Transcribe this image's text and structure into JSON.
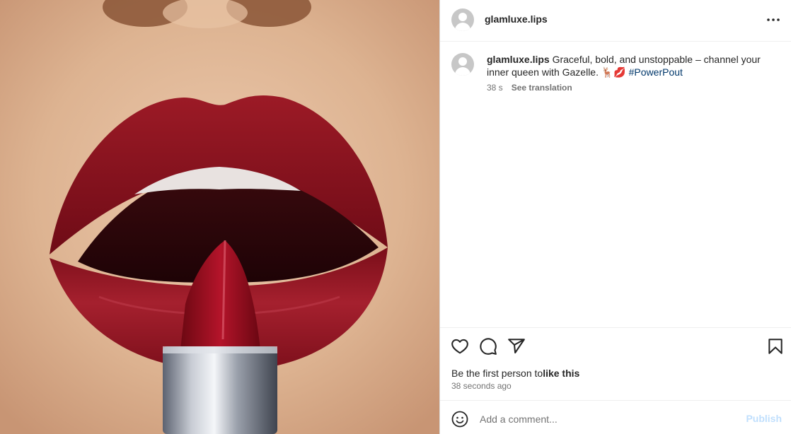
{
  "post": {
    "username": "glamluxe.lips",
    "media_alt": "Close-up of red lips with a red lipstick",
    "caption": {
      "username": "glamluxe.lips",
      "text": " Graceful, bold, and unstoppable – channel your inner queen with Gazelle. 🦌💋 ",
      "hashtag": "#PowerPout",
      "age": "38 s",
      "see_translation": "See translation"
    },
    "likes_prefix": "Be the first person to",
    "likes_action": "like this",
    "timestamp": "38 seconds ago"
  },
  "comment": {
    "placeholder": "Add a comment...",
    "publish_label": "Publish"
  },
  "icons": {
    "more": "more-options-icon",
    "like": "heart-icon",
    "comment": "comment-icon",
    "share": "share-icon",
    "save": "bookmark-icon",
    "emoji": "emoji-icon"
  },
  "colors": {
    "link": "#00376b",
    "secondary_text": "#737373",
    "publish_disabled": "#c0dffd",
    "lipstick_red": "#8b0f1d"
  }
}
